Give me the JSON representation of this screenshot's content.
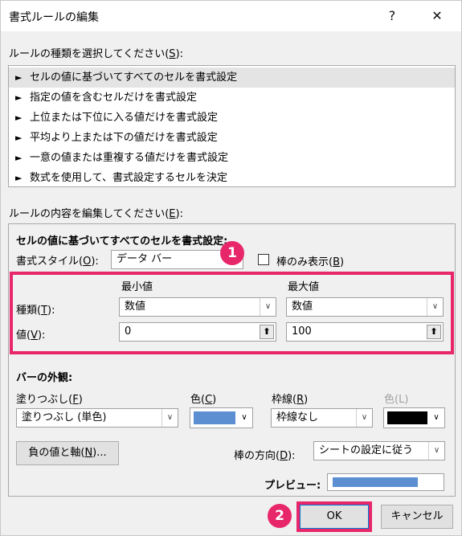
{
  "window": {
    "title": "書式ルールの編集",
    "help": "?",
    "close": "✕"
  },
  "rule_type": {
    "label_prefix": "ルールの種類を選択してください(",
    "label_key": "S",
    "label_suffix": "):",
    "items": [
      "セルの値に基づいてすべてのセルを書式設定",
      "指定の値を含むセルだけを書式設定",
      "上位または下位に入る値だけを書式設定",
      "平均より上または下の値だけを書式設定",
      "一意の値または重複する値だけを書式設定",
      "数式を使用して、書式設定するセルを決定"
    ],
    "selected_index": 0,
    "arrow": "►"
  },
  "rule_edit": {
    "label_prefix": "ルールの内容を編集してください(",
    "label_key": "E",
    "label_suffix": "):",
    "heading": "セルの値に基づいてすべてのセルを書式設定:",
    "format_style_prefix": "書式スタイル(",
    "format_style_key": "O",
    "format_style_suffix": "):",
    "format_style_value": "データ バー",
    "bar_only_prefix": "棒のみ表示(",
    "bar_only_key": "B",
    "bar_only_suffix": ")",
    "bar_only_checked": false,
    "min_header": "最小値",
    "max_header": "最大値",
    "type_prefix": "種類(",
    "type_key": "T",
    "type_suffix": "):",
    "value_prefix": "値(",
    "value_key": "V",
    "value_suffix": "):",
    "min_type": "数値",
    "max_type": "数値",
    "min_value": "0",
    "max_value": "100"
  },
  "appearance": {
    "heading": "バーの外観:",
    "fill_prefix": "塗りつぶし(",
    "fill_key": "F",
    "fill_suffix": ")",
    "fill_value": "塗りつぶし (単色)",
    "color_prefix": "色(",
    "color_key": "C",
    "color_suffix": ")",
    "fill_color": "#5b8fd1",
    "border_prefix": "枠線(",
    "border_key": "R",
    "border_suffix": ")",
    "border_value": "枠線なし",
    "border_color_label": "色(L)",
    "border_color": "#000000",
    "negative_button": "負の値と軸(",
    "negative_key": "N",
    "negative_suffix": ")...",
    "direction_prefix": "棒の方向(",
    "direction_key": "D",
    "direction_suffix": "):",
    "direction_value": "シートの設定に従う",
    "preview_label": "プレビュー:"
  },
  "buttons": {
    "ok": "OK",
    "cancel": "キャンセル"
  },
  "annotations": {
    "badge1": "1",
    "badge2": "2",
    "highlight_color": "#e8276b"
  }
}
